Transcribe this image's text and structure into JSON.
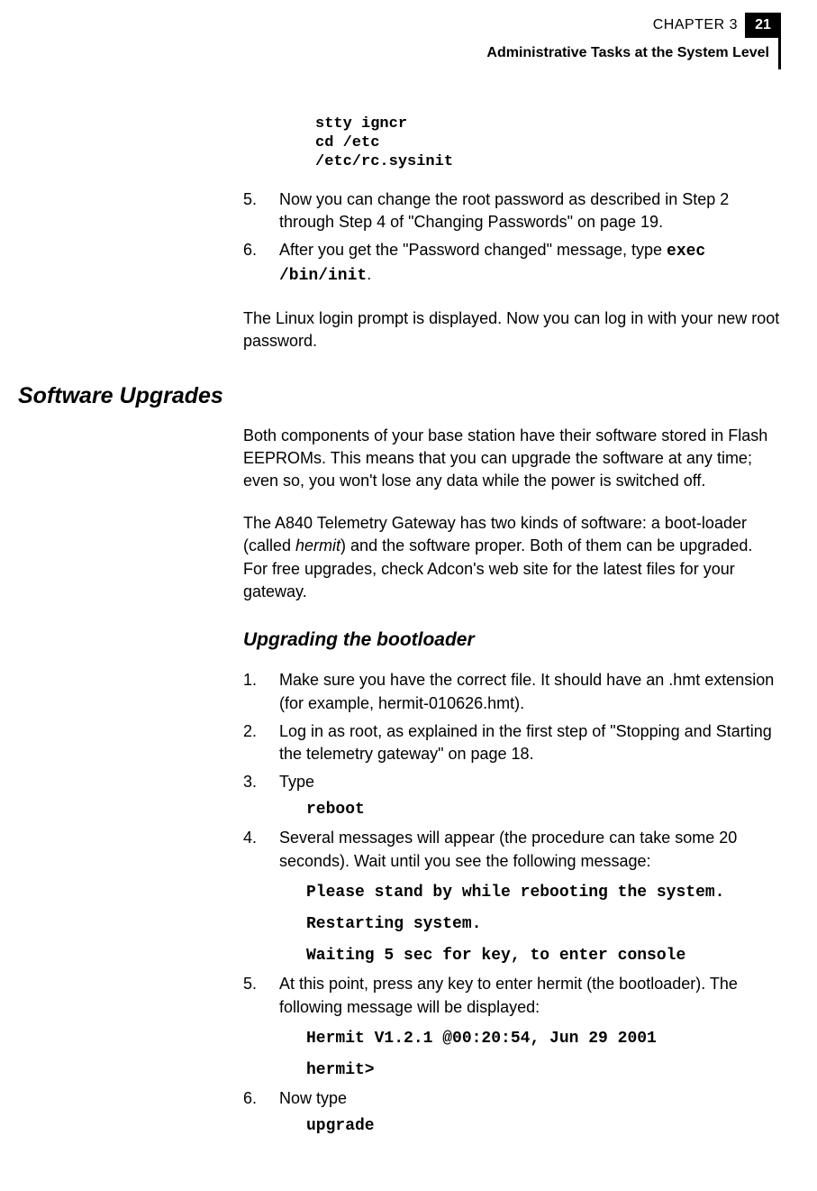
{
  "header": {
    "chapter": "CHAPTER 3",
    "page": "21",
    "title": "Administrative Tasks at the System Level"
  },
  "pre_code": "stty igncr\ncd /etc\n/etc/rc.sysinit",
  "steps_a": {
    "s5": {
      "num": "5.",
      "text": "Now you can change the root password as described in Step 2 through Step 4 of \"Changing Passwords\" on page 19."
    },
    "s6": {
      "num": "6.",
      "prefix": "After you get the \"Password changed\" message, type ",
      "cmd": "exec /bin/init",
      "suffix": "."
    }
  },
  "para1": "The Linux login prompt is displayed. Now you can log in with your new root password.",
  "section_title": "Software Upgrades",
  "para2": "Both components of your base station have their software stored in Flash EEPROMs. This means that you can upgrade the software at any time; even so, you won't lose any data while the power is switched off.",
  "para3_pre": "The A840 Telemetry Gateway has two kinds of software: a boot-loader (called ",
  "para3_italic": "hermit",
  "para3_post": ") and the software proper. Both of them can be upgraded. For free upgrades, check Adcon's web site for the latest files for your gateway.",
  "subsection_title": "Upgrading the bootloader",
  "steps_b": {
    "s1": {
      "num": "1.",
      "text": "Make sure you have the correct file. It should have an .hmt extension (for example, hermit-010626.hmt)."
    },
    "s2": {
      "num": "2.",
      "text": "Log in as root, as explained in the first step of \"Stopping and Starting the telemetry gateway\" on page 18."
    },
    "s3": {
      "num": "3.",
      "text": "Type",
      "cmd": "reboot"
    },
    "s4": {
      "num": "4.",
      "text": "Several messages will appear (the procedure can take some 20 seconds). Wait until you see the following message:",
      "m1": "Please stand by while rebooting the system.",
      "m2": "Restarting system.",
      "m3": "Waiting 5 sec for key, to enter console"
    },
    "s5": {
      "num": "5.",
      "text": "At this point, press any key to enter hermit (the bootloader). The following message will be displayed:",
      "m1": "Hermit V1.2.1 @00:20:54, Jun 29 2001",
      "m2": "hermit>"
    },
    "s6": {
      "num": "6.",
      "text": "Now type",
      "cmd": "upgrade"
    }
  }
}
